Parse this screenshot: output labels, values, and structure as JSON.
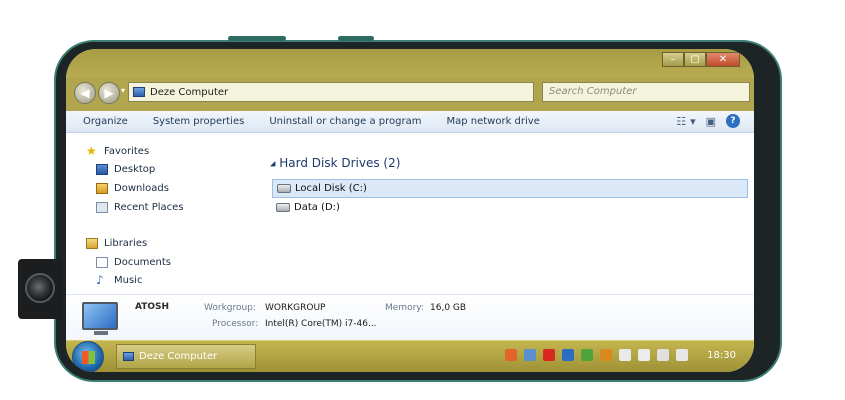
{
  "window": {
    "controls": {
      "minimize": "–",
      "maximize": "▢",
      "close": "✕"
    }
  },
  "address": {
    "back": "◀",
    "forward": "▶",
    "dropdown": "▾",
    "location": "Deze Computer",
    "search_placeholder": "Search Computer"
  },
  "toolbar": {
    "items": [
      "Organize",
      "System properties",
      "Uninstall or change a program",
      "Map network drive"
    ],
    "view_icon": "view-options-icon",
    "view_arrow": "▾",
    "preview_icon": "preview-pane-icon",
    "help": "?"
  },
  "sidebar": {
    "favorites_label": "Favorites",
    "favorites": [
      "Desktop",
      "Downloads",
      "Recent Places"
    ],
    "libraries_label": "Libraries",
    "libraries": [
      "Documents",
      "Music"
    ]
  },
  "main": {
    "group_header": "Hard Disk Drives (2)",
    "group_arrow": "◢",
    "drives": [
      "Local Disk (C:)",
      "Data (D:)"
    ]
  },
  "details": {
    "computer_name": "ATOSH",
    "workgroup_label": "Workgroup:",
    "workgroup_value": "WORKGROUP",
    "memory_label": "Memory:",
    "memory_value": "16,0 GB",
    "processor_label": "Processor:",
    "processor_value": "Intel(R) Core(TM) i7-46..."
  },
  "taskbar": {
    "window_label": "Deze Computer",
    "clock": "18:30",
    "tray_icons": [
      {
        "name": "tray-app-orange-icon",
        "color": "#e3632c"
      },
      {
        "name": "tray-network-icon",
        "color": "#5a8fd0"
      },
      {
        "name": "tray-pdf-icon",
        "color": "#d8281f"
      },
      {
        "name": "tray-outlook-icon",
        "color": "#2d6cc3"
      },
      {
        "name": "tray-green-icon",
        "color": "#4ea33b"
      },
      {
        "name": "tray-update-icon",
        "color": "#d98a1c"
      },
      {
        "name": "tray-document-icon",
        "color": "#e9e9e9"
      },
      {
        "name": "tray-flag-icon",
        "color": "#ececec"
      },
      {
        "name": "tray-monitor-icon",
        "color": "#e0e0e0"
      },
      {
        "name": "tray-volume-icon",
        "color": "#e8e8e8"
      }
    ]
  },
  "colors": {
    "titlebar": "#b1a54e",
    "selection": "#dbe8f8",
    "link_text": "#1e3a6a"
  }
}
